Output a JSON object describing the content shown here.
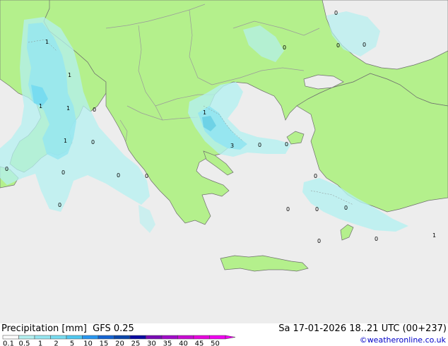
{
  "header": {
    "product": "Precipitation [mm]",
    "model": "GFS 0.25",
    "valid": "Sa 17-01-2026 18..21 UTC (00+237)",
    "credit": "©weatheronline.co.uk"
  },
  "legend": {
    "ticks": [
      "0.1",
      "0.5",
      "1",
      "2",
      "5",
      "10",
      "15",
      "20",
      "25",
      "30",
      "35",
      "40",
      "45",
      "50"
    ],
    "colors": [
      "#fefefe",
      "#b4f0f0",
      "#96e6f0",
      "#78dcf0",
      "#50c8f0",
      "#2896f0",
      "#1464d2",
      "#0a46aa",
      "#0a0aa0",
      "#780ab4",
      "#a00ac8",
      "#c80ad2",
      "#e600dc",
      "#f000f0"
    ]
  },
  "map": {
    "colors": {
      "land": "#b4f08c",
      "sea": "#ededed",
      "border": "#9a9a9a",
      "coast": "#6e6e6e",
      "precip_light": "#b4f0f0",
      "precip_mid": "#96e6f0",
      "precip_heavy": "#6ed2e6"
    },
    "contour_labels": [
      "1",
      "1",
      "1",
      "1",
      "0",
      "1",
      "0",
      "0",
      "0",
      "0",
      "0",
      "1",
      "3",
      "0",
      "0",
      "0",
      "0",
      "0",
      "0",
      "0",
      "0",
      "0",
      "0",
      "0",
      "1"
    ]
  }
}
